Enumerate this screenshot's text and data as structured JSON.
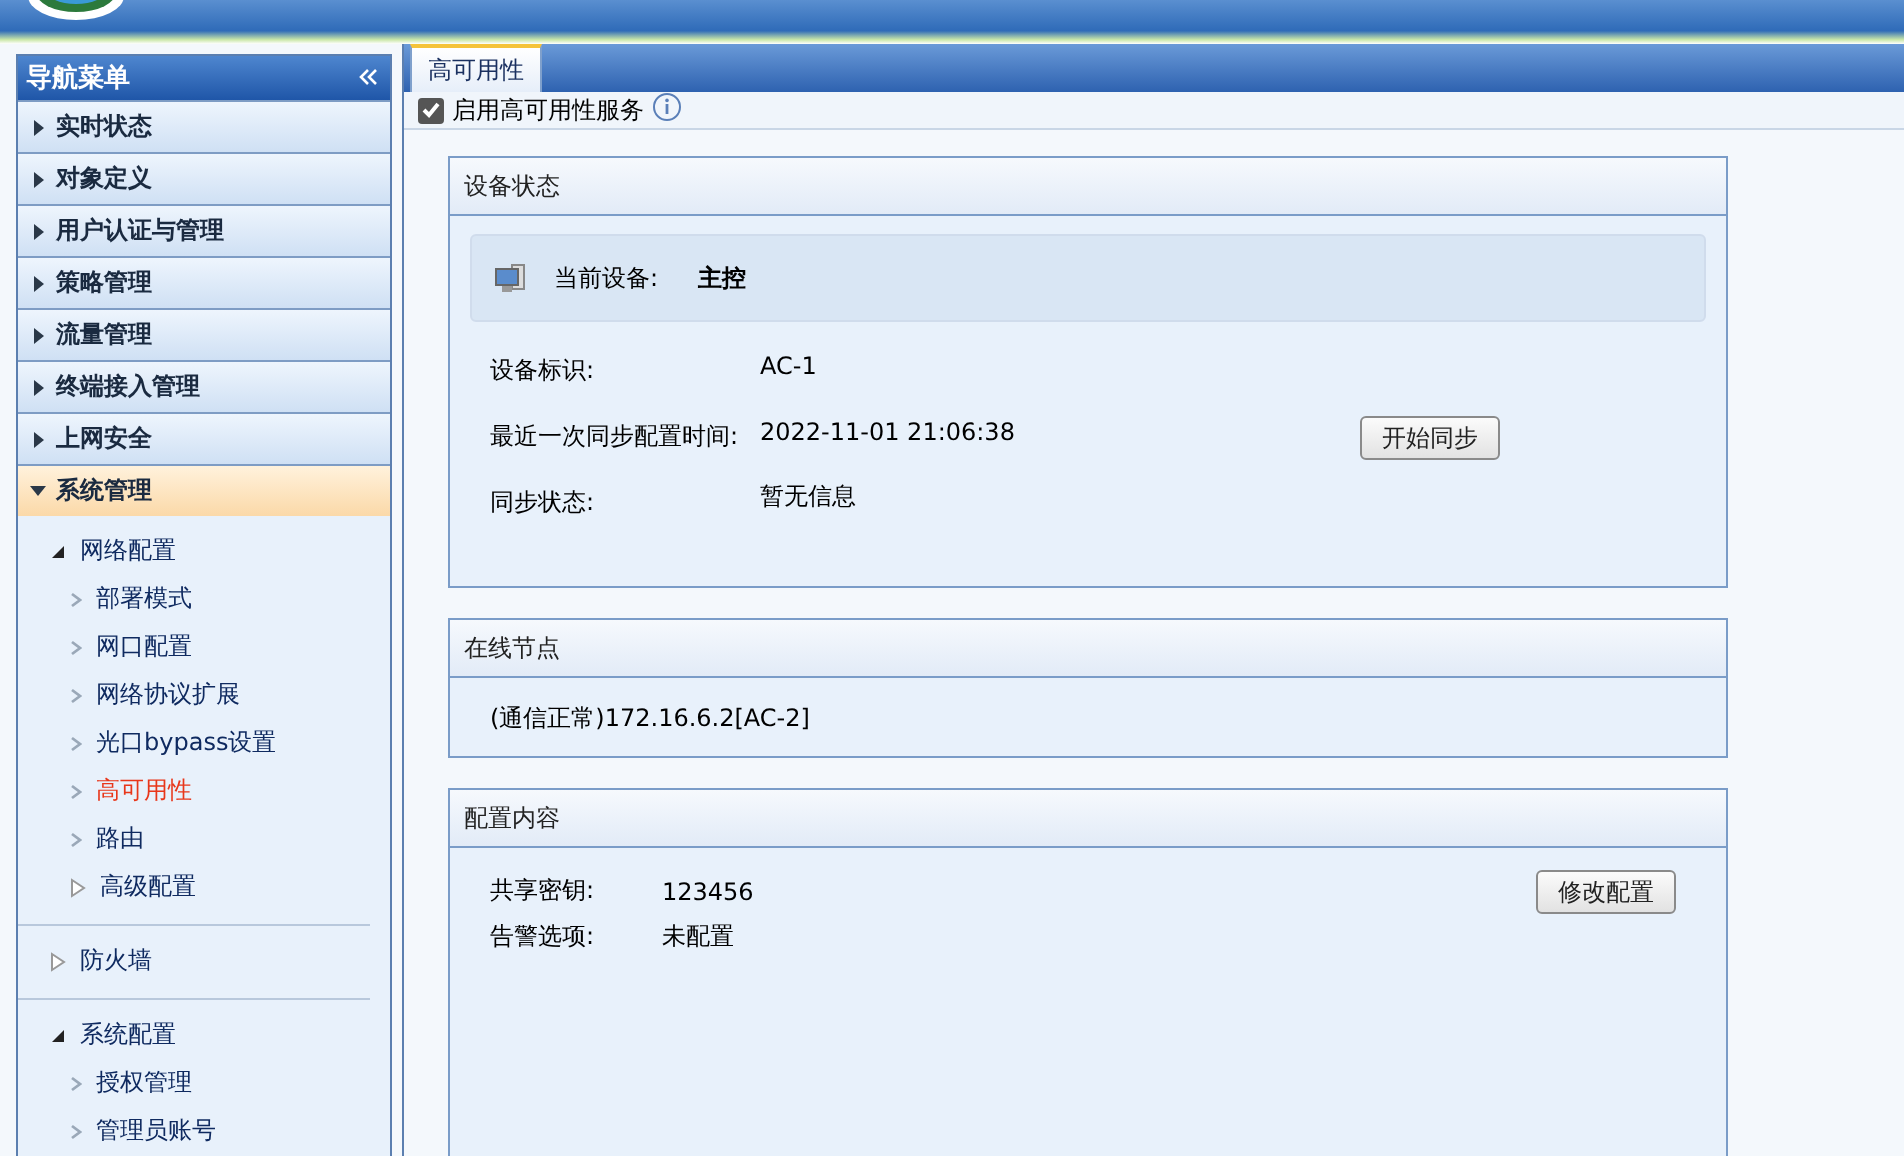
{
  "nav": {
    "title": "导航菜单",
    "items": [
      {
        "label": "实时状态",
        "expanded": false
      },
      {
        "label": "对象定义",
        "expanded": false
      },
      {
        "label": "用户认证与管理",
        "expanded": false
      },
      {
        "label": "策略管理",
        "expanded": false
      },
      {
        "label": "流量管理",
        "expanded": false
      },
      {
        "label": "终端接入管理",
        "expanded": false
      },
      {
        "label": "上网安全",
        "expanded": false
      },
      {
        "label": "系统管理",
        "expanded": true,
        "children": [
          {
            "label": "网络配置",
            "expanded": true,
            "children": [
              {
                "label": "部署模式",
                "selected": false
              },
              {
                "label": "网口配置",
                "selected": false
              },
              {
                "label": "网络协议扩展",
                "selected": false
              },
              {
                "label": "光口bypass设置",
                "selected": false
              },
              {
                "label": "高可用性",
                "selected": true
              },
              {
                "label": "路由",
                "selected": false
              },
              {
                "label": "高级配置",
                "expanded": false
              }
            ]
          },
          {
            "label": "防火墙",
            "expanded": false
          },
          {
            "label": "系统配置",
            "expanded": true,
            "children": [
              {
                "label": "授权管理",
                "selected": false
              },
              {
                "label": "管理员账号",
                "selected": false
              }
            ]
          }
        ]
      }
    ]
  },
  "tabs": [
    {
      "label": "高可用性",
      "selected": true
    }
  ],
  "service": {
    "label": "启用高可用性服务",
    "checked": true
  },
  "device_status": {
    "title": "设备状态",
    "current_label": "当前设备:",
    "current_value": "主控",
    "rows": [
      {
        "label": "设备标识:",
        "value": "AC-1"
      },
      {
        "label": "最近一次同步配置时间:",
        "value": "2022-11-01 21:06:38"
      },
      {
        "label": "同步状态:",
        "value": "暂无信息"
      }
    ],
    "sync_button": "开始同步"
  },
  "online_nodes": {
    "title": "在线节点",
    "nodes": [
      "(通信正常)172.16.6.2[AC-2]"
    ]
  },
  "config": {
    "title": "配置内容",
    "rows": [
      {
        "label": "共享密钥:",
        "value": "123456"
      },
      {
        "label": "告警选项:",
        "value": "未配置"
      }
    ],
    "edit_button": "修改配置"
  }
}
